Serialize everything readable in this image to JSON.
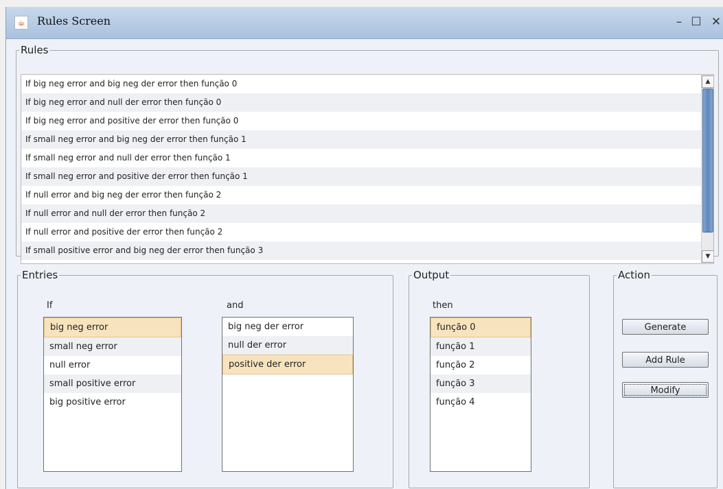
{
  "window": {
    "title": "Rules Screen",
    "icon": "java-cup-icon",
    "controls": {
      "minimize": "–",
      "maximize": "☐",
      "close": "✕"
    }
  },
  "rules": {
    "legend": "Rules",
    "items": [
      "If big neg error and big neg der error  then função 0",
      "If big neg error and null der error  then função 0",
      "If big neg error and positive der error  then função 0",
      "If small neg error  and big neg der error  then função 1",
      "If small neg error  and null der error  then função 1",
      "If small neg error  and positive der error  then função 1",
      "If null error  and big neg der error  then função 2",
      "If null error  and null der error  then função 2",
      "If null error  and positive der error  then função 2",
      "If small positive error  and big neg der error  then função 3"
    ]
  },
  "entries": {
    "legend": "Entries",
    "if_label": "If",
    "and_label": "and",
    "if_items": [
      "big neg error",
      "small neg error",
      "null error",
      "small positive error",
      "big positive error"
    ],
    "if_selected": "big neg error",
    "and_items": [
      "big neg der error",
      "null der error",
      "positive der error"
    ],
    "and_selected": "positive der error"
  },
  "output": {
    "legend": "Output",
    "then_label": "then",
    "items": [
      "função 0",
      "função 1",
      "função 2",
      "função 3",
      "função 4"
    ],
    "selected": "função 0"
  },
  "action": {
    "legend": "Action",
    "generate": "Generate",
    "add_rule": "Add Rule",
    "modify": "Modify"
  }
}
